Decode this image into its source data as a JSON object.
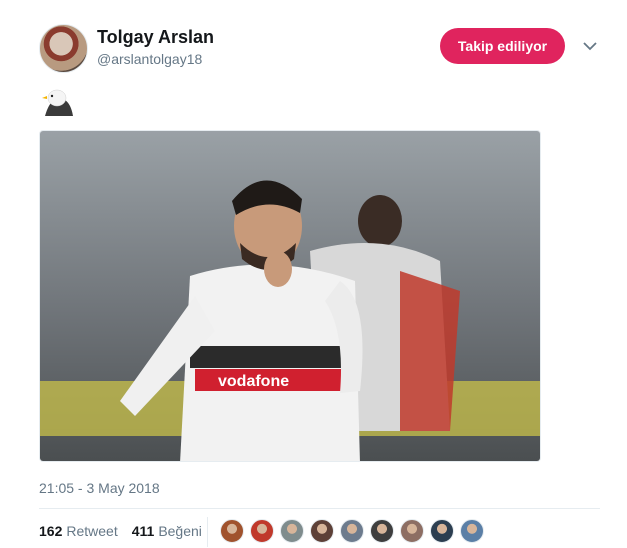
{
  "user": {
    "name": "Tolgay Arslan",
    "handle": "@arslantolgay18"
  },
  "follow_button": {
    "label": "Takip ediliyor",
    "color": "#e0245e"
  },
  "tweet": {
    "emoji": "eagle-emoji",
    "media": {
      "jersey_text": "vodafone"
    },
    "timestamp": "21:05 - 3 May 2018"
  },
  "stats": {
    "retweets_count": "162",
    "retweets_label": "Retweet",
    "likes_count": "411",
    "likes_label": "Beğeni"
  },
  "likers": [
    {
      "color": "#a0522d"
    },
    {
      "color": "#c0392b"
    },
    {
      "color": "#7f8c8d"
    },
    {
      "color": "#5d4037"
    },
    {
      "color": "#6d7b8d"
    },
    {
      "color": "#3e3e3e"
    },
    {
      "color": "#8d6e63"
    },
    {
      "color": "#2c3e50"
    },
    {
      "color": "#5b7fa6"
    }
  ]
}
